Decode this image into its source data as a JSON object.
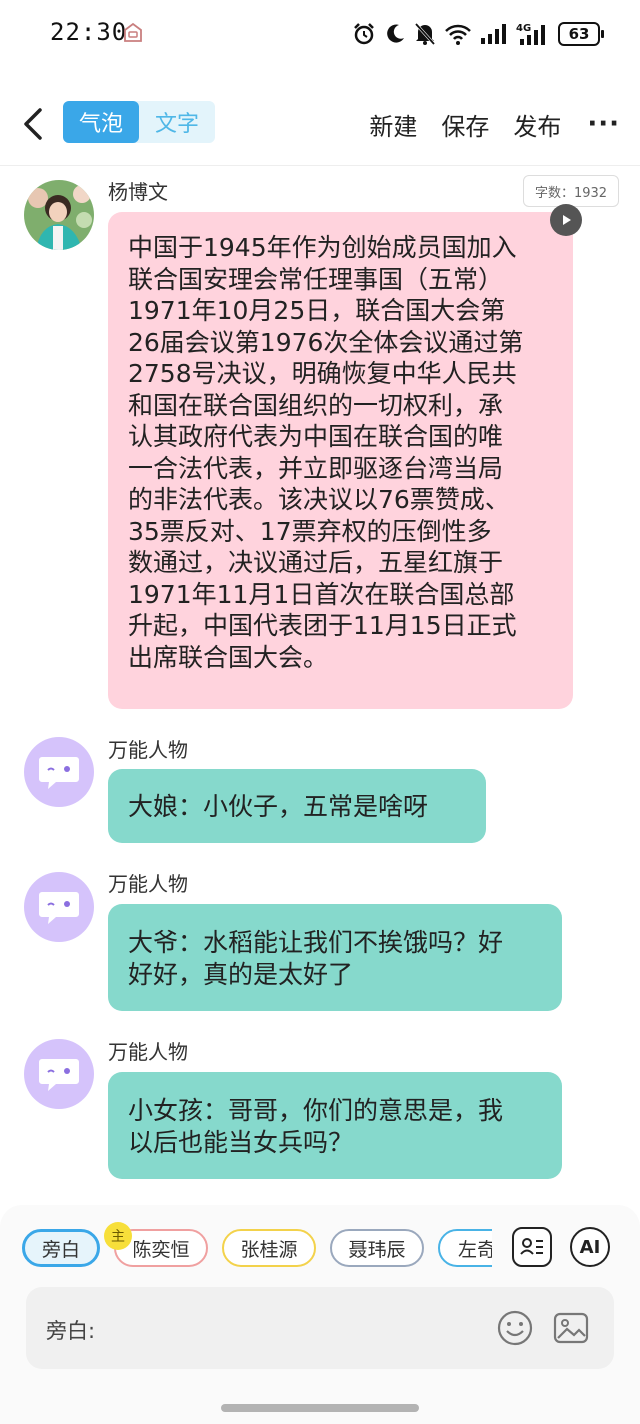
{
  "status_bar": {
    "time": "22:30",
    "battery": "63",
    "network": "4G"
  },
  "top_bar": {
    "tabs": [
      {
        "label": "气泡",
        "active": true
      },
      {
        "label": "文字",
        "active": false
      }
    ],
    "actions": {
      "new_label": "新建",
      "save_label": "保存",
      "publish_label": "发布",
      "more_label": "···"
    }
  },
  "word_count": "字数：1932",
  "messages": [
    {
      "sender": "杨博文",
      "lines": [
        "中国于1945年作为创始成员国加入",
        "联合国安理会常任理事国（五常）",
        "1971年10月25日，联合国大会第",
        "26届会议第1976次全体会议通过第",
        "2758号决议，明确恢复中华人民共",
        "和国在联合国组织的一切权利，承",
        "认其政府代表为中国在联合国的唯",
        "一合法代表，并立即驱逐台湾当局",
        "的非法代表。该决议以76票赞成、",
        "35票反对、17票弃权的压倒性多",
        "数通过，决议通过后，五星红旗于",
        "1971年11月1日首次在联合国总部",
        "升起，中国代表团于11月15日正式",
        "出席联合国大会。"
      ]
    },
    {
      "sender": "万能人物",
      "lines": [
        "大娘：小伙子，五常是啥呀"
      ]
    },
    {
      "sender": "万能人物",
      "lines": [
        "大爷：水稻能让我们不挨饿吗？好",
        "好好，真的是太好了"
      ]
    },
    {
      "sender": "万能人物",
      "lines": [
        "小女孩：哥哥，你们的意思是，我",
        "以后也能当女兵吗？"
      ]
    }
  ],
  "character_chips": [
    {
      "label": "旁白",
      "selected": true
    },
    {
      "label": "陈奕恒",
      "selected": false
    },
    {
      "label": "张桂源",
      "selected": false
    },
    {
      "label": "聂玮辰",
      "selected": false
    },
    {
      "label": "左奇",
      "selected": false
    }
  ],
  "main_badge": "主",
  "ai_button_label": "AI",
  "input": {
    "label": "旁白:",
    "value": "",
    "placeholder": ""
  },
  "colors": {
    "accent": "#3aa7e8",
    "pink_bubble": "#ffd3dd",
    "teal_bubble": "#86d9cc",
    "robot_avatar": "#d5c3fb"
  },
  "icons": {
    "back": "chevron-left-icon",
    "alarm": "alarm-icon",
    "moon": "moon-icon",
    "mute": "bell-off-icon",
    "wifi": "wifi-icon",
    "signal": "signal-icon",
    "play": "play-icon",
    "contacts": "contact-card-icon",
    "emoji": "smile-icon",
    "image": "image-icon"
  }
}
